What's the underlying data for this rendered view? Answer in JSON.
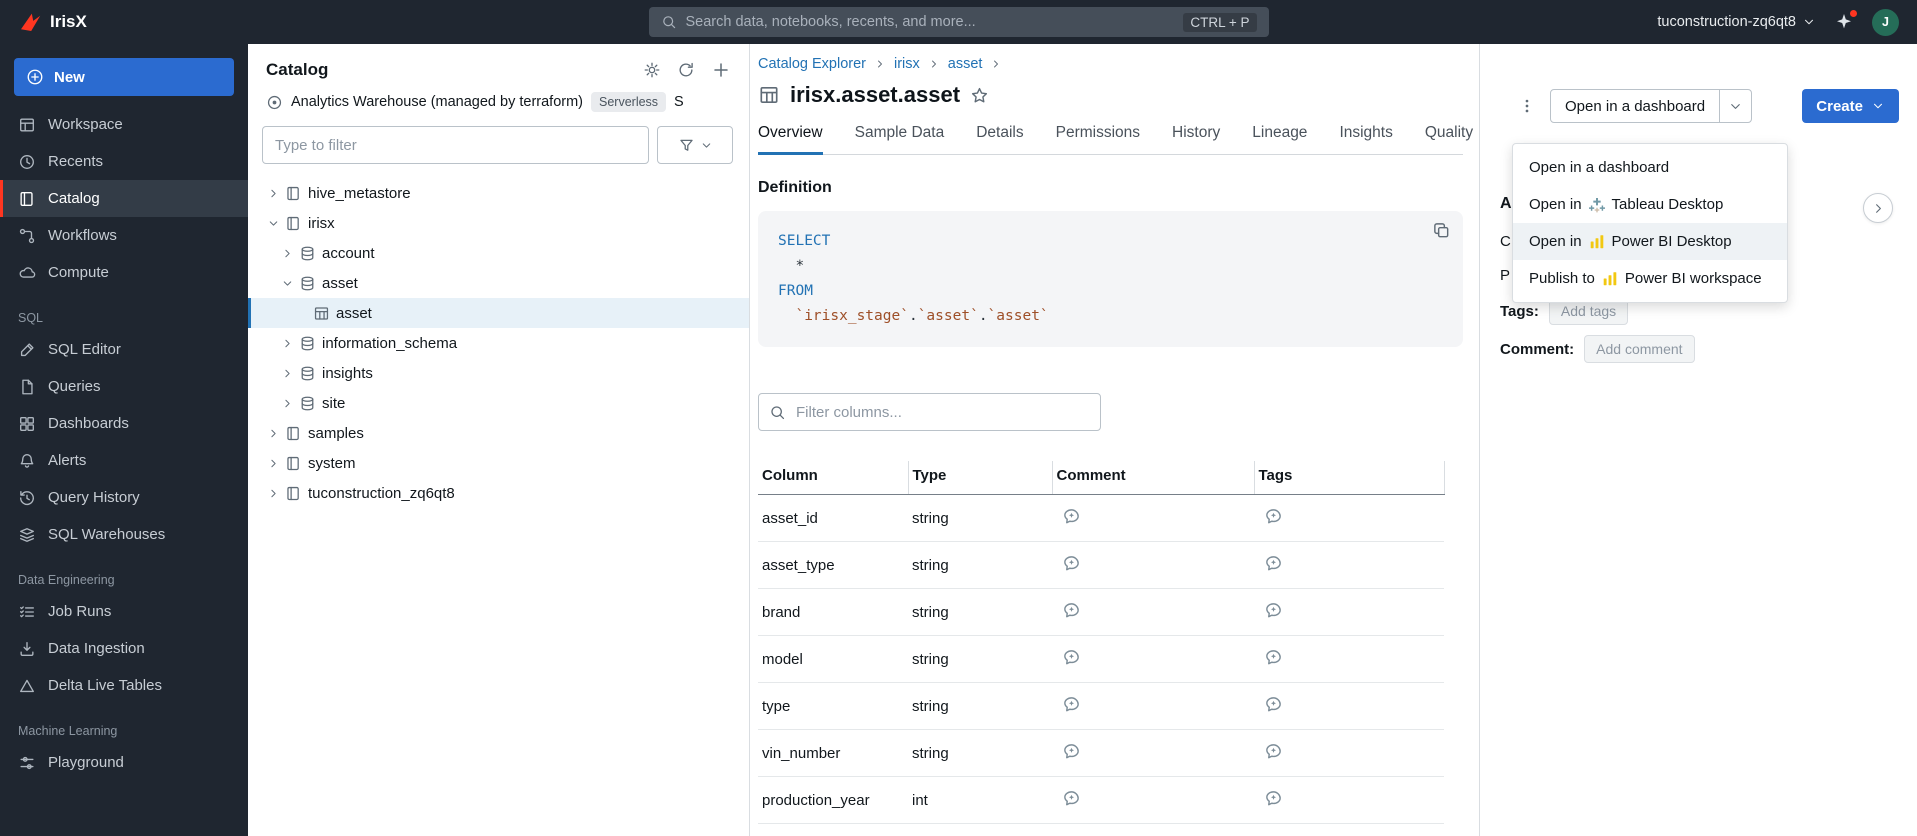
{
  "colors": {
    "brand_red": "#ff3621",
    "accent_blue": "#2b6bd0",
    "link_blue": "#2272b4",
    "powerbi_yellow": "#f2c811"
  },
  "topbar": {
    "app_name": "IrisX",
    "search_placeholder": "Search data, notebooks, recents, and more...",
    "search_shortcut": "CTRL + P",
    "workspace_name": "tuconstruction-zq6qt8",
    "avatar_initial": "J"
  },
  "sidebar": {
    "new_button": "New",
    "groups": [
      {
        "label": "",
        "items": [
          {
            "label": "Workspace",
            "icon": "workspace",
            "active": false
          },
          {
            "label": "Recents",
            "icon": "recents",
            "active": false
          },
          {
            "label": "Catalog",
            "icon": "catalog",
            "active": true
          },
          {
            "label": "Workflows",
            "icon": "workflows",
            "active": false
          },
          {
            "label": "Compute",
            "icon": "compute",
            "active": false
          }
        ]
      },
      {
        "label": "SQL",
        "items": [
          {
            "label": "SQL Editor",
            "icon": "sql-editor",
            "active": false
          },
          {
            "label": "Queries",
            "icon": "queries",
            "active": false
          },
          {
            "label": "Dashboards",
            "icon": "dashboards",
            "active": false
          },
          {
            "label": "Alerts",
            "icon": "alerts",
            "active": false
          },
          {
            "label": "Query History",
            "icon": "query-history",
            "active": false
          },
          {
            "label": "SQL Warehouses",
            "icon": "sql-warehouses",
            "active": false
          }
        ]
      },
      {
        "label": "Data Engineering",
        "items": [
          {
            "label": "Job Runs",
            "icon": "job-runs",
            "active": false
          },
          {
            "label": "Data Ingestion",
            "icon": "data-ingestion",
            "active": false
          },
          {
            "label": "Delta Live Tables",
            "icon": "delta-live-tables",
            "active": false
          }
        ]
      },
      {
        "label": "Machine Learning",
        "items": [
          {
            "label": "Playground",
            "icon": "playground",
            "active": false
          }
        ]
      }
    ]
  },
  "catalog_panel": {
    "title": "Catalog",
    "metastore_name": "Analytics Warehouse (managed by terraform)",
    "metastore_badge": "Serverless",
    "metastore_truncated": "S",
    "filter_placeholder": "Type to filter",
    "tree": [
      {
        "label": "hive_metastore",
        "icon": "catalog-book",
        "level": 1,
        "expanded": false,
        "selected": false
      },
      {
        "label": "irisx",
        "icon": "catalog-book",
        "level": 1,
        "expanded": true,
        "selected": false
      },
      {
        "label": "account",
        "icon": "schema",
        "level": 2,
        "expanded": false,
        "selected": false
      },
      {
        "label": "asset",
        "icon": "schema",
        "level": 2,
        "expanded": true,
        "selected": false
      },
      {
        "label": "asset",
        "icon": "table-grid",
        "level": 3,
        "expanded": null,
        "selected": true
      },
      {
        "label": "information_schema",
        "icon": "schema",
        "level": 2,
        "expanded": false,
        "selected": false
      },
      {
        "label": "insights",
        "icon": "schema",
        "level": 2,
        "expanded": false,
        "selected": false
      },
      {
        "label": "site",
        "icon": "schema",
        "level": 2,
        "expanded": false,
        "selected": false
      },
      {
        "label": "samples",
        "icon": "catalog-book",
        "level": 1,
        "expanded": false,
        "selected": false
      },
      {
        "label": "system",
        "icon": "catalog-book",
        "level": 1,
        "expanded": false,
        "selected": false
      },
      {
        "label": "tuconstruction_zq6qt8",
        "icon": "catalog-book",
        "level": 1,
        "expanded": false,
        "selected": false
      }
    ]
  },
  "main": {
    "breadcrumbs": [
      "Catalog Explorer",
      "irisx",
      "asset"
    ],
    "title": "irisx.asset.asset",
    "tabs": [
      {
        "label": "Overview",
        "active": true
      },
      {
        "label": "Sample Data",
        "active": false
      },
      {
        "label": "Details",
        "active": false
      },
      {
        "label": "Permissions",
        "active": false
      },
      {
        "label": "History",
        "active": false
      },
      {
        "label": "Lineage",
        "active": false
      },
      {
        "label": "Insights",
        "active": false
      },
      {
        "label": "Quality",
        "active": false
      }
    ],
    "definition_heading": "Definition",
    "sql": [
      [
        {
          "t": "SELECT",
          "c": "kw"
        }
      ],
      [
        {
          "t": "  *",
          "c": "p"
        }
      ],
      [
        {
          "t": "FROM",
          "c": "kw"
        }
      ],
      [
        {
          "t": "  ",
          "c": "p"
        },
        {
          "t": "`irisx_stage`",
          "c": "id"
        },
        {
          "t": ".",
          "c": "p"
        },
        {
          "t": "`asset`",
          "c": "id"
        },
        {
          "t": ".",
          "c": "p"
        },
        {
          "t": "`asset`",
          "c": "id"
        }
      ]
    ],
    "filter_columns_placeholder": "Filter columns...",
    "columns_table": {
      "headers": [
        "Column",
        "Type",
        "Comment",
        "Tags"
      ],
      "rows": [
        {
          "column": "asset_id",
          "type": "string"
        },
        {
          "column": "asset_type",
          "type": "string"
        },
        {
          "column": "brand",
          "type": "string"
        },
        {
          "column": "model",
          "type": "string"
        },
        {
          "column": "type",
          "type": "string"
        },
        {
          "column": "vin_number",
          "type": "string"
        },
        {
          "column": "production_year",
          "type": "int"
        }
      ]
    }
  },
  "right_panel": {
    "open_button": "Open in a dashboard",
    "create_button": "Create",
    "occluded_labels": [
      "A",
      "C",
      "P"
    ],
    "tags_label": "Tags:",
    "add_tags": "Add tags",
    "comment_label": "Comment:",
    "add_comment": "Add comment"
  },
  "open_menu": {
    "items": [
      {
        "prefix": "Open in a dashboard",
        "icon": "",
        "suffix": "",
        "highlighted": false
      },
      {
        "prefix": "Open in",
        "icon": "tableau",
        "suffix": "Tableau Desktop",
        "highlighted": false
      },
      {
        "prefix": "Open in",
        "icon": "powerbi",
        "suffix": "Power BI Desktop",
        "highlighted": true
      },
      {
        "prefix": "Publish to",
        "icon": "powerbi",
        "suffix": "Power BI workspace",
        "highlighted": false
      }
    ]
  }
}
